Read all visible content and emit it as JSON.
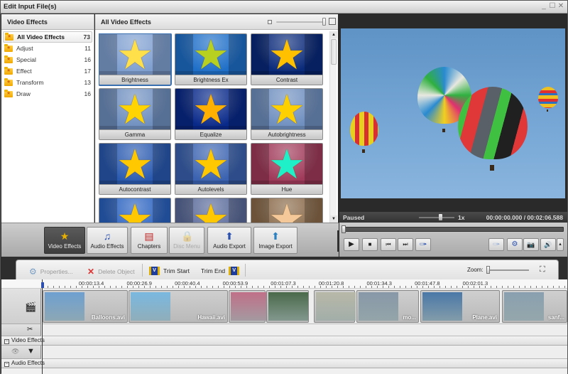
{
  "window": {
    "title": "Edit Input File(s)",
    "controls": {
      "minimize": "_",
      "maximize": "☐",
      "close": "✕"
    }
  },
  "categories": {
    "header": "Video Effects",
    "items": [
      {
        "label": "All Video Effects",
        "count": "73",
        "active": true
      },
      {
        "label": "Adjust",
        "count": "11"
      },
      {
        "label": "Special",
        "count": "16"
      },
      {
        "label": "Effect",
        "count": "17"
      },
      {
        "label": "Transform",
        "count": "13"
      },
      {
        "label": "Draw",
        "count": "16"
      }
    ]
  },
  "effects": {
    "header": "All Video Effects",
    "items": [
      {
        "label": "Brightness",
        "bg": "#7f9fd0",
        "star": "#ffe04a",
        "selected": true
      },
      {
        "label": "Brightness Ex",
        "bg": "#1f6fc8",
        "star": "#b8d020"
      },
      {
        "label": "Contrast",
        "bg": "#0a2a7a",
        "star": "#ffc000"
      },
      {
        "label": "Gamma",
        "bg": "#6f8fbf",
        "star": "#ffd400"
      },
      {
        "label": "Equalize",
        "bg": "#0a2a8a",
        "star": "#ffb000"
      },
      {
        "label": "Autobrightness",
        "bg": "#6f8fbf",
        "star": "#ffd000"
      },
      {
        "label": "Autocontrast",
        "bg": "#2a5ab0",
        "star": "#ffc800"
      },
      {
        "label": "Autolevels",
        "bg": "#3a62b0",
        "star": "#ffc800"
      },
      {
        "label": "Hue",
        "bg": "#a03a5a",
        "star": "#20f0c8"
      },
      {
        "label": "",
        "bg": "#2a62c0",
        "star": "#ffc800"
      },
      {
        "label": "",
        "bg": "#5a6a9a",
        "star": "#ffc800"
      },
      {
        "label": "",
        "bg": "#8a6a4a",
        "star": "#f5c89a"
      }
    ]
  },
  "preview": {
    "status": "Paused",
    "speed": "1x",
    "time": "00:00:00.000 / 00:02:06.588",
    "seek_position_percent": 0
  },
  "toolbar": {
    "buttons": [
      {
        "label": "Video Effects",
        "icon": "★",
        "active": true
      },
      {
        "label": "Audio Effects",
        "icon": "♫"
      },
      {
        "label": "Chapters",
        "icon": "▤"
      },
      {
        "label": "Disc Menu",
        "icon": "🔒",
        "disabled": true
      },
      {
        "label": "Audio Export",
        "icon": "⬆"
      },
      {
        "label": "Image Export",
        "icon": "⬆"
      }
    ]
  },
  "transport": {
    "buttons": [
      "▶",
      "■",
      "⏮",
      "⏭",
      "▭▸",
      "▭▸",
      "⚙",
      "📷",
      "🔊",
      "▴"
    ]
  },
  "timeline_toolbar": {
    "properties": "Properties...",
    "delete": "Delete Object",
    "trim_start": "Trim Start",
    "trim_end": "Trim End",
    "zoom_label": "Zoom:",
    "zoom_level_percent": 0
  },
  "timeline": {
    "ruler": [
      "00:00:13.4",
      "00:00:26.9",
      "00:00:40.4",
      "00:00:53.9",
      "00:01:07.3",
      "00:01:20.8",
      "00:01:34.3",
      "00:01:47.8",
      "00:02:01.3"
    ],
    "clips": [
      {
        "name": "Balloons.avi",
        "thumb": "#6ea0d0"
      },
      {
        "name": "Hawaii.avi",
        "thumb": "#7ab8e0"
      },
      {
        "name": "",
        "thumb": "#c07088"
      },
      {
        "name": "",
        "thumb": "#4a6a4a"
      },
      {
        "name": "",
        "thumb": "#b8b8a8"
      },
      {
        "name": "mo...",
        "thumb": "#8898a8"
      },
      {
        "name": "Plane.avi",
        "thumb": "#4a78a8"
      },
      {
        "name": "sanf...",
        "thumb": "#8aa0b0"
      }
    ],
    "sections": [
      "Video Effects",
      "Audio Effects"
    ]
  }
}
